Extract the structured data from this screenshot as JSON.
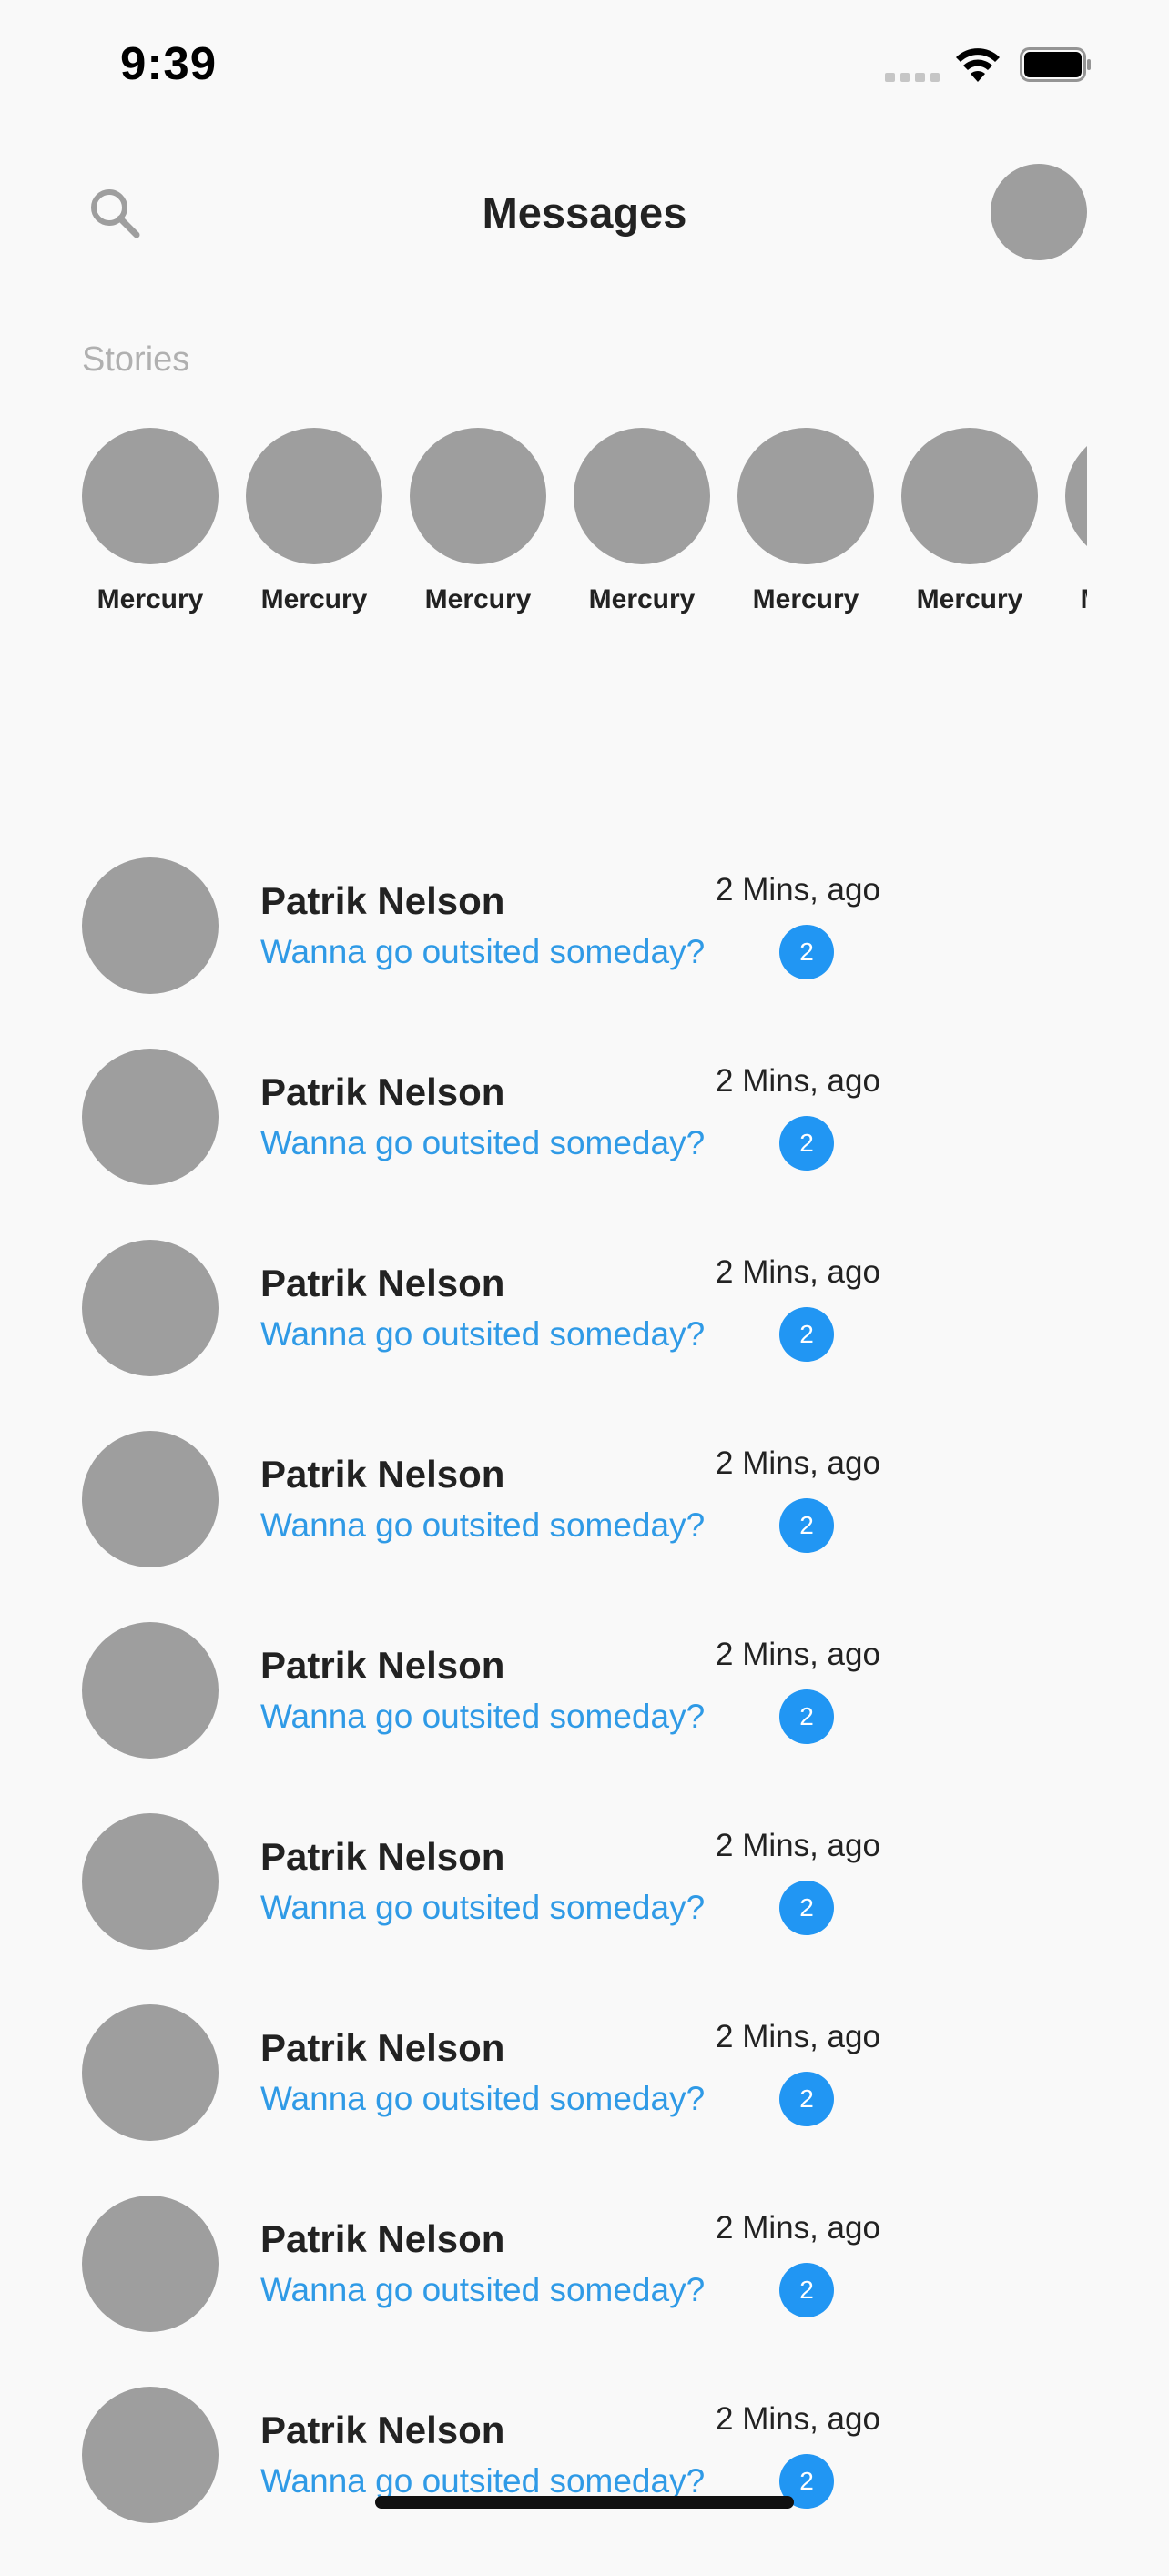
{
  "status_bar": {
    "time": "9:39",
    "signal_icon": "cellular-signal-icon",
    "wifi_icon": "wifi-icon",
    "battery_icon": "battery-icon"
  },
  "header": {
    "title": "Messages",
    "search_icon": "search-icon",
    "profile_icon": "profile-avatar"
  },
  "stories": {
    "label": "Stories",
    "items": [
      {
        "name": "Mercury"
      },
      {
        "name": "Mercury"
      },
      {
        "name": "Mercury"
      },
      {
        "name": "Mercury"
      },
      {
        "name": "Mercury"
      },
      {
        "name": "Mercury"
      },
      {
        "name": "Mercury"
      }
    ]
  },
  "conversations": [
    {
      "name": "Patrik Nelson",
      "time": "2 Mins, ago",
      "preview": "Wanna go outsited someday?",
      "unread": "2"
    },
    {
      "name": "Patrik Nelson",
      "time": "2 Mins, ago",
      "preview": "Wanna go outsited someday?",
      "unread": "2"
    },
    {
      "name": "Patrik Nelson",
      "time": "2 Mins, ago",
      "preview": "Wanna go outsited someday?",
      "unread": "2"
    },
    {
      "name": "Patrik Nelson",
      "time": "2 Mins, ago",
      "preview": "Wanna go outsited someday?",
      "unread": "2"
    },
    {
      "name": "Patrik Nelson",
      "time": "2 Mins, ago",
      "preview": "Wanna go outsited someday?",
      "unread": "2"
    },
    {
      "name": "Patrik Nelson",
      "time": "2 Mins, ago",
      "preview": "Wanna go outsited someday?",
      "unread": "2"
    },
    {
      "name": "Patrik Nelson",
      "time": "2 Mins, ago",
      "preview": "Wanna go outsited someday?",
      "unread": "2"
    },
    {
      "name": "Patrik Nelson",
      "time": "2 Mins, ago",
      "preview": "Wanna go outsited someday?",
      "unread": "2"
    },
    {
      "name": "Patrik Nelson",
      "time": "2 Mins, ago",
      "preview": "Wanna go outsited someday?",
      "unread": "2"
    }
  ],
  "colors": {
    "background": "#f9f9f9",
    "accent": "#2196f3",
    "preview_text": "#2f9ae6",
    "placeholder_avatar": "#9e9e9e",
    "muted_text": "#b0b0b0"
  }
}
